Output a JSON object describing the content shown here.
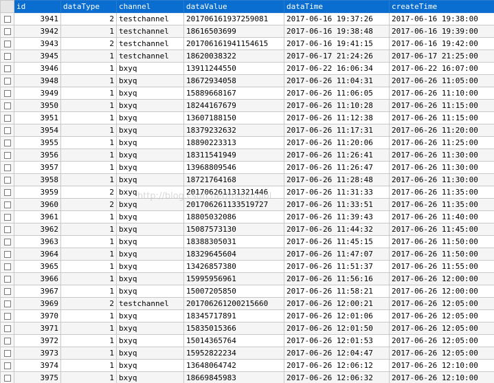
{
  "columns": {
    "id": "id",
    "dataType": "dataType",
    "channel": "channel",
    "dataValue": "dataValue",
    "dataTime": "dataTime",
    "createTime": "createTime"
  },
  "watermark": "http://blog.csdn.net/mollinglol",
  "rows": [
    {
      "id": "3941",
      "dataType": "2",
      "channel": "testchannel",
      "dataValue": "201706161937259081",
      "dataTime": "2017-06-16 19:37:26",
      "createTime": "2017-06-16 19:38:00"
    },
    {
      "id": "3942",
      "dataType": "1",
      "channel": "testchannel",
      "dataValue": "18616503699",
      "dataTime": "2017-06-16 19:38:48",
      "createTime": "2017-06-16 19:39:00"
    },
    {
      "id": "3943",
      "dataType": "2",
      "channel": "testchannel",
      "dataValue": "201706161941154615",
      "dataTime": "2017-06-16 19:41:15",
      "createTime": "2017-06-16 19:42:00"
    },
    {
      "id": "3945",
      "dataType": "1",
      "channel": "testchannel",
      "dataValue": "18620038322",
      "dataTime": "2017-06-17 21:24:26",
      "createTime": "2017-06-17 21:25:00"
    },
    {
      "id": "3946",
      "dataType": "1",
      "channel": "bxyq",
      "dataValue": "13911244550",
      "dataTime": "2017-06-22 16:06:34",
      "createTime": "2017-06-22 16:07:00"
    },
    {
      "id": "3948",
      "dataType": "1",
      "channel": "bxyq",
      "dataValue": "18672934058",
      "dataTime": "2017-06-26 11:04:31",
      "createTime": "2017-06-26 11:05:00"
    },
    {
      "id": "3949",
      "dataType": "1",
      "channel": "bxyq",
      "dataValue": "15889668167",
      "dataTime": "2017-06-26 11:06:05",
      "createTime": "2017-06-26 11:10:00"
    },
    {
      "id": "3950",
      "dataType": "1",
      "channel": "bxyq",
      "dataValue": "18244167679",
      "dataTime": "2017-06-26 11:10:28",
      "createTime": "2017-06-26 11:15:00"
    },
    {
      "id": "3951",
      "dataType": "1",
      "channel": "bxyq",
      "dataValue": "13607188150",
      "dataTime": "2017-06-26 11:12:38",
      "createTime": "2017-06-26 11:15:00"
    },
    {
      "id": "3954",
      "dataType": "1",
      "channel": "bxyq",
      "dataValue": "18379232632",
      "dataTime": "2017-06-26 11:17:31",
      "createTime": "2017-06-26 11:20:00"
    },
    {
      "id": "3955",
      "dataType": "1",
      "channel": "bxyq",
      "dataValue": "18890223313",
      "dataTime": "2017-06-26 11:20:06",
      "createTime": "2017-06-26 11:25:00"
    },
    {
      "id": "3956",
      "dataType": "1",
      "channel": "bxyq",
      "dataValue": "18311541949",
      "dataTime": "2017-06-26 11:26:41",
      "createTime": "2017-06-26 11:30:00"
    },
    {
      "id": "3957",
      "dataType": "1",
      "channel": "bxyq",
      "dataValue": "13968809546",
      "dataTime": "2017-06-26 11:26:47",
      "createTime": "2017-06-26 11:30:00"
    },
    {
      "id": "3958",
      "dataType": "1",
      "channel": "bxyq",
      "dataValue": "18721764168",
      "dataTime": "2017-06-26 11:28:48",
      "createTime": "2017-06-26 11:30:00"
    },
    {
      "id": "3959",
      "dataType": "2",
      "channel": "bxyq",
      "dataValue": "201706261131321446",
      "dataTime": "2017-06-26 11:31:33",
      "createTime": "2017-06-26 11:35:00"
    },
    {
      "id": "3960",
      "dataType": "2",
      "channel": "bxyq",
      "dataValue": "201706261133519727",
      "dataTime": "2017-06-26 11:33:51",
      "createTime": "2017-06-26 11:35:00"
    },
    {
      "id": "3961",
      "dataType": "1",
      "channel": "bxyq",
      "dataValue": "18805032086",
      "dataTime": "2017-06-26 11:39:43",
      "createTime": "2017-06-26 11:40:00"
    },
    {
      "id": "3962",
      "dataType": "1",
      "channel": "bxyq",
      "dataValue": "15087573130",
      "dataTime": "2017-06-26 11:44:32",
      "createTime": "2017-06-26 11:45:00"
    },
    {
      "id": "3963",
      "dataType": "1",
      "channel": "bxyq",
      "dataValue": "18388305031",
      "dataTime": "2017-06-26 11:45:15",
      "createTime": "2017-06-26 11:50:00"
    },
    {
      "id": "3964",
      "dataType": "1",
      "channel": "bxyq",
      "dataValue": "18329645604",
      "dataTime": "2017-06-26 11:47:07",
      "createTime": "2017-06-26 11:50:00"
    },
    {
      "id": "3965",
      "dataType": "1",
      "channel": "bxyq",
      "dataValue": "13426857380",
      "dataTime": "2017-06-26 11:51:37",
      "createTime": "2017-06-26 11:55:00"
    },
    {
      "id": "3966",
      "dataType": "1",
      "channel": "bxyq",
      "dataValue": "15995956961",
      "dataTime": "2017-06-26 11:56:16",
      "createTime": "2017-06-26 12:00:00"
    },
    {
      "id": "3967",
      "dataType": "1",
      "channel": "bxyq",
      "dataValue": "15007205850",
      "dataTime": "2017-06-26 11:58:21",
      "createTime": "2017-06-26 12:00:00"
    },
    {
      "id": "3969",
      "dataType": "2",
      "channel": "testchannel",
      "dataValue": "201706261200215660",
      "dataTime": "2017-06-26 12:00:21",
      "createTime": "2017-06-26 12:05:00"
    },
    {
      "id": "3970",
      "dataType": "1",
      "channel": "bxyq",
      "dataValue": "18345717891",
      "dataTime": "2017-06-26 12:01:06",
      "createTime": "2017-06-26 12:05:00"
    },
    {
      "id": "3971",
      "dataType": "1",
      "channel": "bxyq",
      "dataValue": "15835015366",
      "dataTime": "2017-06-26 12:01:50",
      "createTime": "2017-06-26 12:05:00"
    },
    {
      "id": "3972",
      "dataType": "1",
      "channel": "bxyq",
      "dataValue": "15014365764",
      "dataTime": "2017-06-26 12:01:53",
      "createTime": "2017-06-26 12:05:00"
    },
    {
      "id": "3973",
      "dataType": "1",
      "channel": "bxyq",
      "dataValue": "15952822234",
      "dataTime": "2017-06-26 12:04:47",
      "createTime": "2017-06-26 12:05:00"
    },
    {
      "id": "3974",
      "dataType": "1",
      "channel": "bxyq",
      "dataValue": "13648064742",
      "dataTime": "2017-06-26 12:06:12",
      "createTime": "2017-06-26 12:10:00"
    },
    {
      "id": "3975",
      "dataType": "1",
      "channel": "bxyq",
      "dataValue": "18669845983",
      "dataTime": "2017-06-26 12:06:32",
      "createTime": "2017-06-26 12:10:00"
    }
  ]
}
